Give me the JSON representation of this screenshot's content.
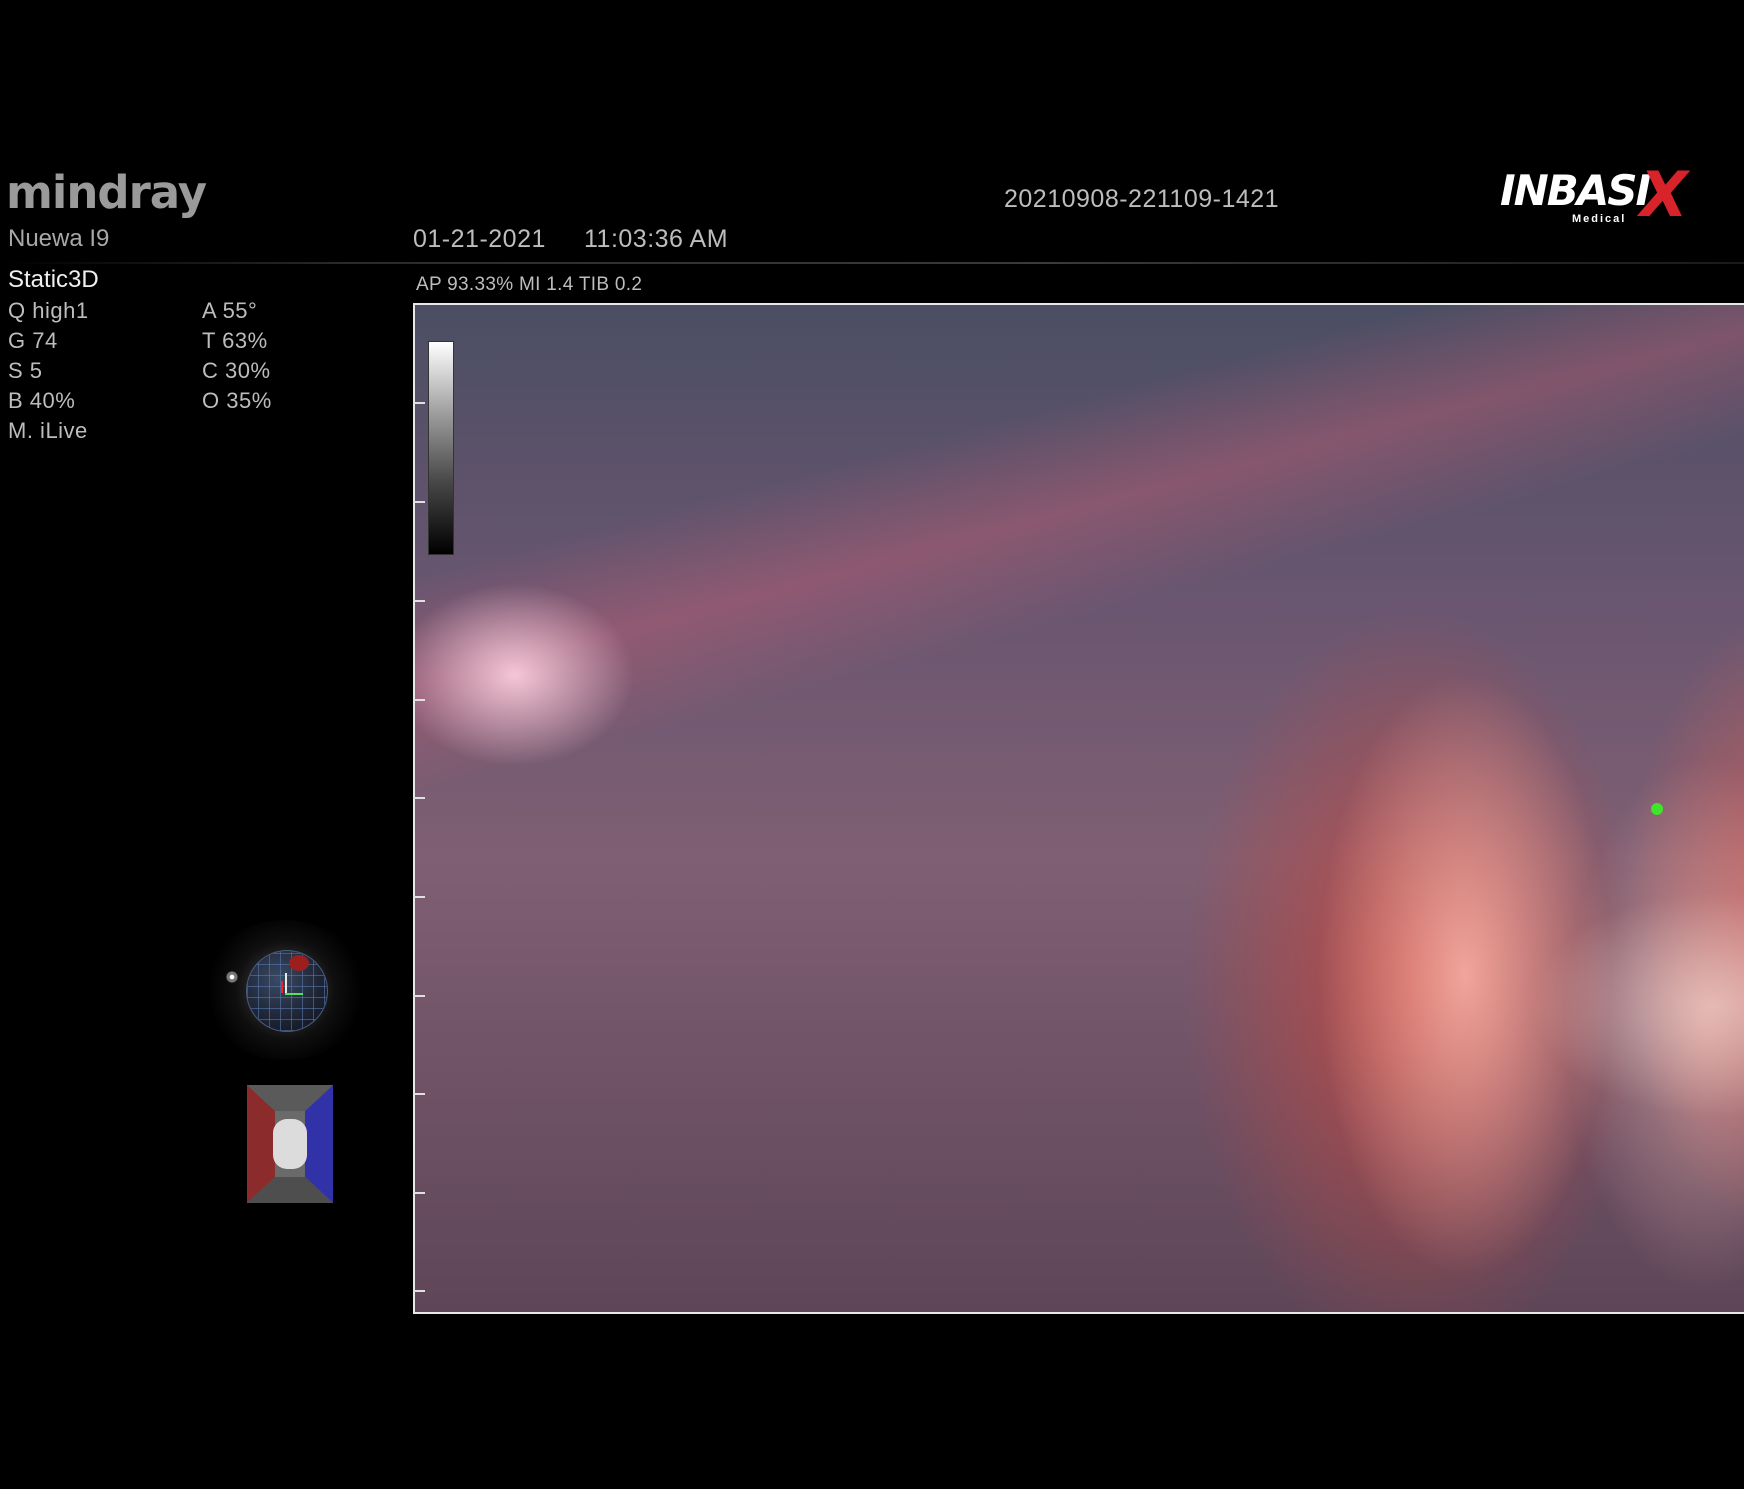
{
  "header": {
    "brand": "mindray",
    "model": "Nuewa I9",
    "date": "01-21-2021",
    "time": "11:03:36 AM",
    "study_id": "20210908-221109-1421",
    "partner_logo_text": "INBASIX",
    "partner_logo_main": "INBASI",
    "partner_logo_x": "X",
    "partner_logo_sub": "Medical"
  },
  "mode": "Static3D",
  "params_left": [
    "Q high1",
    "G 74",
    "S 5",
    "B 40%",
    "M. iLive"
  ],
  "params_right": [
    "A 55°",
    "T 63%",
    "C 30%",
    "O 35%"
  ],
  "acoustic": "AP 93.33%  MI 1.4 TIB 0.2",
  "colors": {
    "background": "#000000",
    "text": "#bdbdbd",
    "frame_border": "#e8e8e8",
    "marker": "#3ee62a",
    "logo_x": "#d8232a",
    "cube_red": "#8b2b2b",
    "cube_blue": "#3232a8"
  },
  "icons": {
    "orientation": "orientation-globe-icon",
    "render_box": "render-box-icon",
    "marker": "green-dot-marker"
  }
}
